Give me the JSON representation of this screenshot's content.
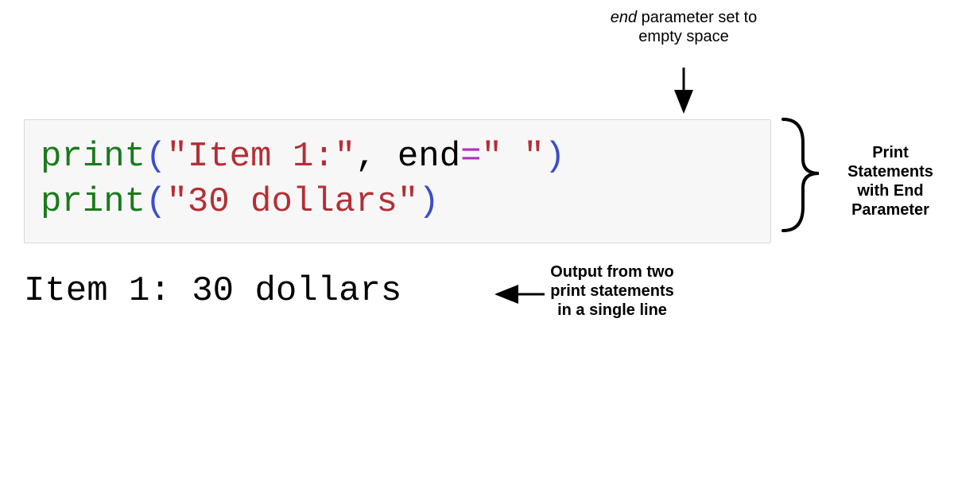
{
  "annotations": {
    "top": {
      "italic_word": "end",
      "rest": " parameter set to empty space"
    },
    "right": "Print Statements with End Parameter",
    "output": "Output from two print statements in a single line"
  },
  "code": {
    "line1": {
      "func": "print",
      "open": "(",
      "str1": "\"Item 1:\"",
      "comma": ", ",
      "kw": "end",
      "eq": "=",
      "str2": "\" \"",
      "close": ")"
    },
    "line2": {
      "func": "print",
      "open": "(",
      "str": "\"30 dollars\"",
      "close": ")"
    }
  },
  "output_text": "Item 1: 30 dollars"
}
